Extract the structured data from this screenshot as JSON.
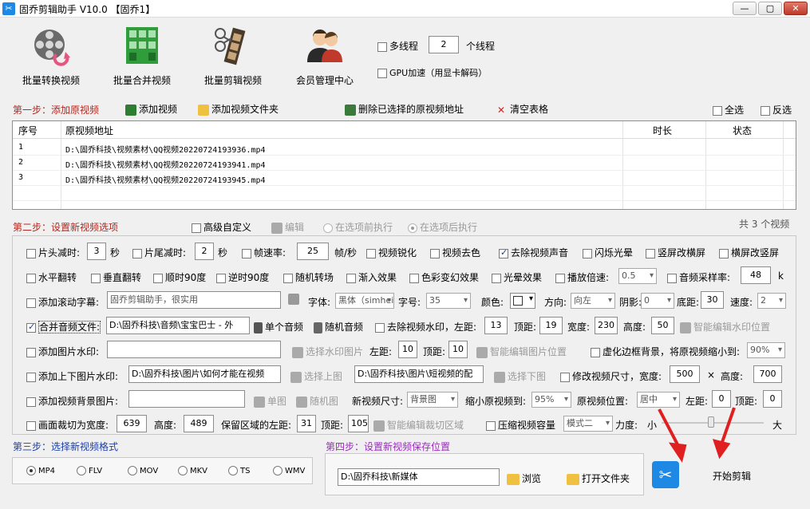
{
  "window": {
    "title": "固乔剪辑助手 V10.0  【固乔1】",
    "btn_min": "—",
    "btn_max": "▢",
    "btn_close": "✕"
  },
  "toolbar": {
    "batch_convert": "批量转换视频",
    "batch_merge": "批量合并视频",
    "batch_cut": "批量剪辑视频",
    "member": "会员管理中心",
    "multithread_label": "多线程",
    "thread_count": "2",
    "thread_unit": "个线程",
    "gpu_label": "GPU加速（用显卡解码）"
  },
  "step1": {
    "title": "第一步：添加原视频",
    "add_video": "添加视频",
    "add_folder": "添加视频文件夹",
    "delete_selected": "删除已选择的原视频地址",
    "clear_table": "清空表格",
    "select_all": "全选",
    "invert": "反选"
  },
  "table": {
    "headers": {
      "no": "序号",
      "path": "原视频地址",
      "duration": "时长",
      "status": "状态"
    },
    "rows": [
      {
        "no": "1",
        "path": "D:\\固乔科技\\视频素材\\QQ视频20220724193936.mp4"
      },
      {
        "no": "2",
        "path": "D:\\固乔科技\\视频素材\\QQ视频20220724193941.mp4"
      },
      {
        "no": "3",
        "path": "D:\\固乔科技\\视频素材\\QQ视频20220724193945.mp4"
      }
    ]
  },
  "step2": {
    "title": "第二步：设置新视频选项",
    "advanced": "高级自定义",
    "edit": "编辑",
    "before": "在选项前执行",
    "after": "在选项后执行",
    "count": "共 3 个视频"
  },
  "opts": {
    "head_cut": "片头减时:",
    "head_val": "3",
    "sec1": "秒",
    "tail_cut": "片尾减时:",
    "tail_val": "2",
    "sec2": "秒",
    "fps": "帧速率:",
    "fps_val": "25",
    "fps_unit": "帧/秒",
    "sharpen": "视频锐化",
    "decolor": "视频去色",
    "remove_audio": "去除视频声音",
    "flash": "闪烁光晕",
    "v2h": "竖屏改横屏",
    "h2v": "横屏改竖屏",
    "hflip": "水平翻转",
    "vflip": "垂直翻转",
    "cw90": "顺时90度",
    "ccw90": "逆时90度",
    "rand_trans": "随机转场",
    "fade_in": "渐入效果",
    "color_fx": "色彩变幻效果",
    "halo": "光晕效果",
    "speed": "播放倍速:",
    "speed_val": "0.5",
    "sample_rate": "音频采样率:",
    "sample_val": "48",
    "sample_unit": "k",
    "scroll_sub": "添加滚动字幕:",
    "scroll_text": "固乔剪辑助手，很实用",
    "font_label": "字体:",
    "font_val": "黑体（simhei）",
    "size_label": "字号:",
    "size_val": "35",
    "color_label": "颜色:",
    "dir_label": "方向:",
    "dir_val": "向左",
    "shadow_label": "阴影:",
    "shadow_val": "0",
    "bottom_label": "底距:",
    "bottom_val": "30",
    "spd_label": "速度:",
    "spd_val": "2",
    "merge_audio": "合并音频文件:",
    "audio_path": "D:\\固乔科技\\音频\\宝宝巴士 - 外",
    "single_audio": "单个音频",
    "rand_audio": "随机音频",
    "rm_watermark": "去除视频水印，左距:",
    "wm_left": "13",
    "wm_top_label": "顶距:",
    "wm_top": "19",
    "wm_w_label": "宽度:",
    "wm_w": "230",
    "wm_h_label": "高度:",
    "wm_h": "50",
    "smart_wm": "智能编辑水印位置",
    "img_wm": "添加图片水印:",
    "choose_wm": "选择水印图片",
    "img_left_label": "左距:",
    "img_left": "10",
    "img_top_label": "顶距:",
    "img_top": "10",
    "smart_img": "智能编辑图片位置",
    "blur_bg": "虚化边框背景，将原视频缩小到:",
    "blur_val": "90%",
    "tb_img_wm": "添加上下图片水印:",
    "top_img_path": "D:\\固乔科技\\图片\\如何才能在视频",
    "choose_top": "选择上图",
    "bottom_img_path": "D:\\固乔科技\\图片\\短视频的配",
    "choose_bottom": "选择下图",
    "resize": "修改视频尺寸，宽度:",
    "resize_w": "500",
    "times": "×",
    "resize_h_label": "高度:",
    "resize_h": "700",
    "bg_img": "添加视频背景图片:",
    "single_img": "单图",
    "rand_img": "随机图",
    "new_size_label": "新视频尺寸:",
    "new_size_val": "背景图",
    "shrink_label": "缩小原视频到:",
    "shrink_val": "95%",
    "pos_label": "原视频位置:",
    "pos_val": "居中",
    "pos_left_label": "左距:",
    "pos_left": "0",
    "pos_top_label": "顶距:",
    "pos_top": "0",
    "crop": "画面裁切为宽度:",
    "crop_w": "639",
    "crop_h_label": "高度:",
    "crop_h": "489",
    "keep_left_label": "保留区域的左距:",
    "keep_left": "31",
    "keep_top_label": "顶距:",
    "keep_top": "105",
    "smart_crop": "智能编辑裁切区域",
    "compress": "压缩视频容量",
    "compress_mode": "模式二",
    "force_label": "力度:",
    "small": "小",
    "big": "大"
  },
  "step3": {
    "title": "第三步：选择新视频格式",
    "formats": [
      "MP4",
      "FLV",
      "MOV",
      "MKV",
      "TS",
      "WMV"
    ],
    "selected": "MP4"
  },
  "step4": {
    "title": "第四步：设置新视频保存位置",
    "path": "D:\\固乔科技\\新媒体",
    "browse": "浏览",
    "open_folder": "打开文件夹"
  },
  "start": {
    "label": "开始剪辑"
  },
  "colors": {
    "step_red": "#b5281f",
    "step_blue": "#1e3ea8",
    "step_purple": "#9b2bbf",
    "arrow": "#e02020"
  }
}
